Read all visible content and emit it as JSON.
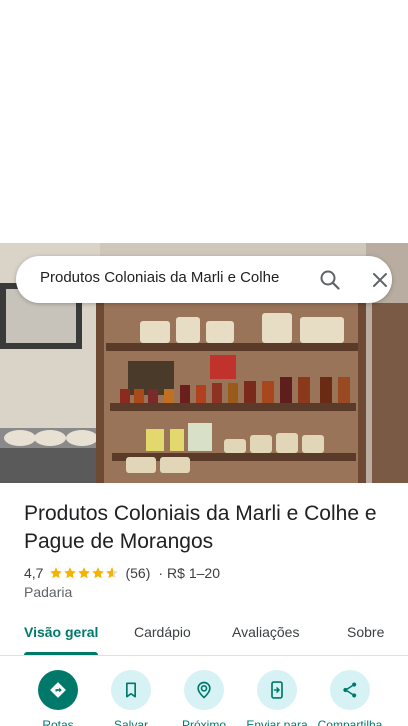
{
  "search": {
    "query": "Produtos Coloniais da Marli e Colhe"
  },
  "place": {
    "title": "Produtos Coloniais da Marli e Colhe e Pague de Morangos",
    "rating": "4,7",
    "stars": 4.7,
    "review_count": "(56)",
    "separator": "·",
    "price_range": "R$ 1–20",
    "category": "Padaria"
  },
  "tabs": [
    {
      "label": "Visão geral",
      "active": true
    },
    {
      "label": "Cardápio",
      "active": false
    },
    {
      "label": "Avaliações",
      "active": false
    },
    {
      "label": "Sobre",
      "active": false
    }
  ],
  "actions": [
    {
      "label": "Rotas",
      "icon": "directions-icon"
    },
    {
      "label": "Salvar",
      "icon": "bookmark-icon"
    },
    {
      "label": "Próximo",
      "icon": "nearby-icon"
    },
    {
      "label": "Enviar para",
      "icon": "send-to-phone-icon"
    },
    {
      "label": "Compartilha",
      "icon": "share-icon"
    }
  ],
  "colors": {
    "accent": "#00796b",
    "action_bg": "#d6f2f5",
    "star": "#f4b400"
  }
}
